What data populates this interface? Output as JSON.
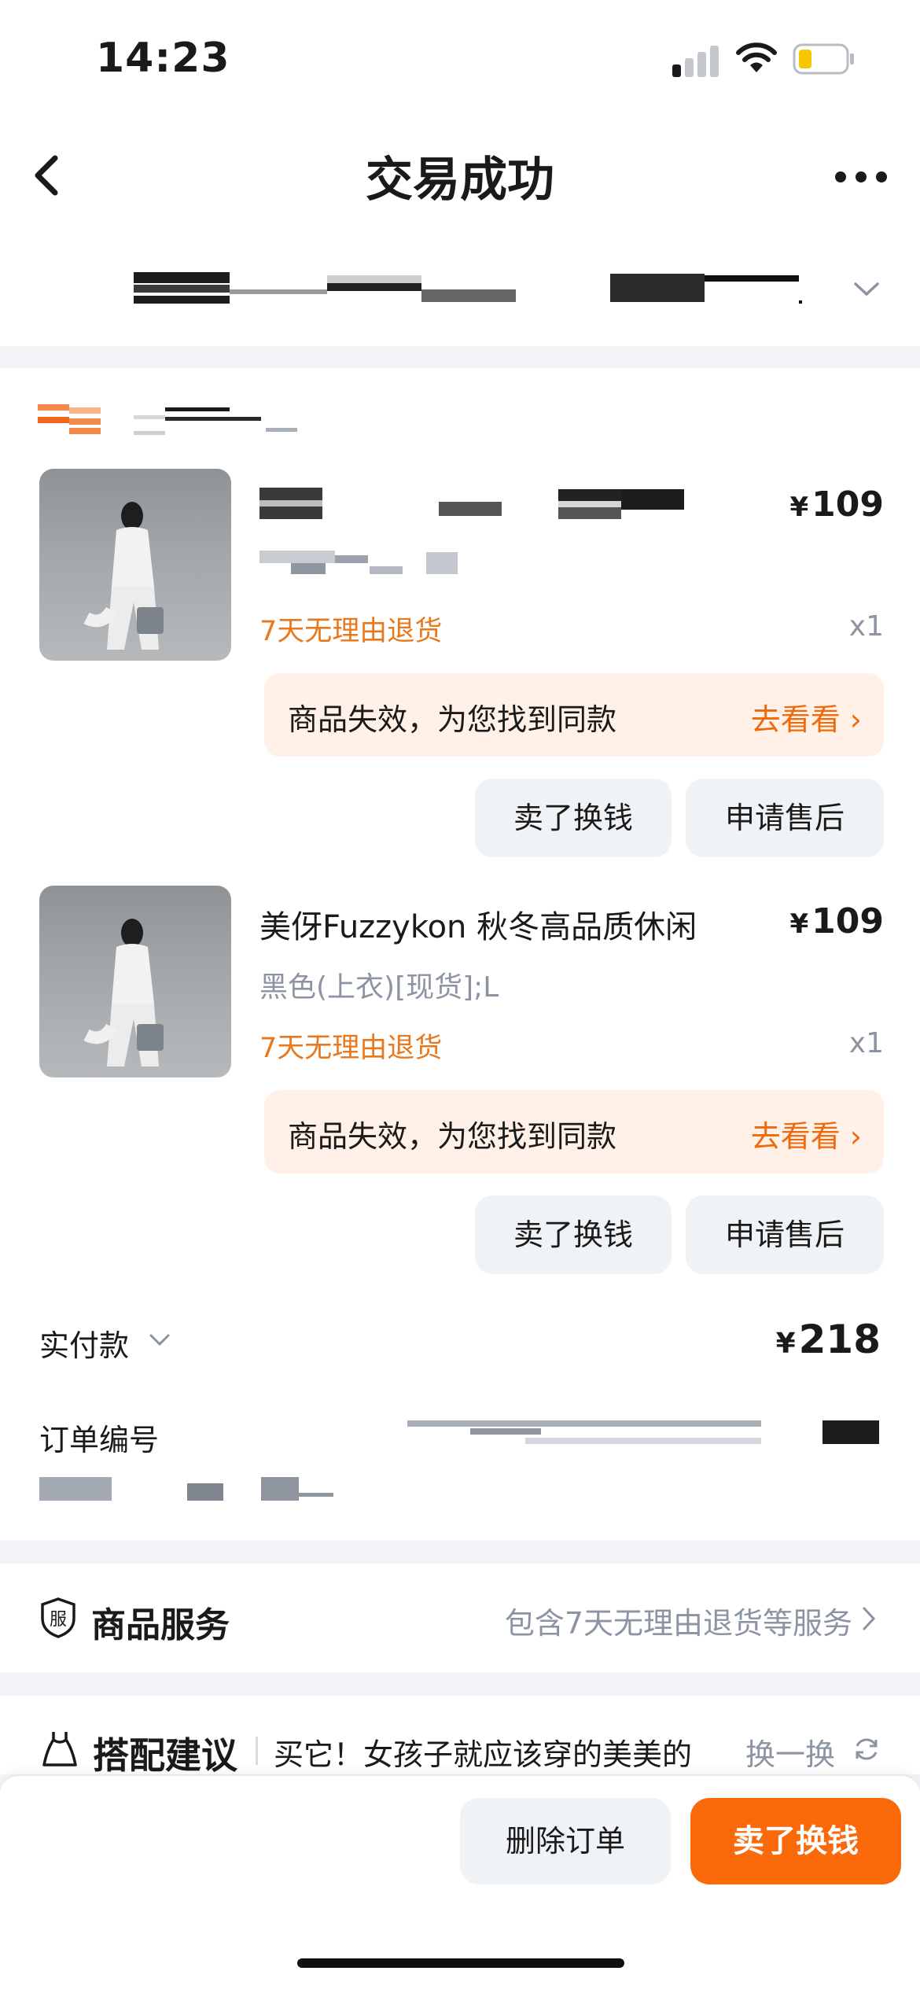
{
  "status_bar": {
    "time": "14:23"
  },
  "header": {
    "title": "交易成功"
  },
  "items": [
    {
      "name": "",
      "price_symbol": "¥",
      "price": "109",
      "spec": "",
      "return_policy": "7天无理由退货",
      "quantity": "x1",
      "notice_text": "商品失效，为您找到同款",
      "notice_link": "去看看 ›",
      "sell_label": "卖了换钱",
      "after_sale_label": "申请售后"
    },
    {
      "name": "美伢Fuzzykon 秋冬高品质休闲",
      "price_symbol": "¥",
      "price": "109",
      "spec": "黑色(上衣)[现货];L",
      "return_policy": "7天无理由退货",
      "quantity": "x1",
      "notice_text": "商品失效，为您找到同款",
      "notice_link": "去看看 ›",
      "sell_label": "卖了换钱",
      "after_sale_label": "申请售后"
    }
  ],
  "payment": {
    "label": "实付款",
    "symbol": "¥",
    "amount": "218"
  },
  "order": {
    "label": "订单编号"
  },
  "service": {
    "title": "商品服务",
    "description": "包含7天无理由退货等服务",
    "icon_char": "服"
  },
  "match": {
    "title": "搭配建议",
    "description": "买它！女孩子就应该穿的美美的",
    "swap_label": "换一换"
  },
  "bottom_bar": {
    "delete_label": "删除订单",
    "sell_label": "卖了换钱"
  },
  "colors": {
    "accent": "#fa6a0a",
    "notice_bg": "#fff1e8",
    "muted": "#8c94a3"
  }
}
